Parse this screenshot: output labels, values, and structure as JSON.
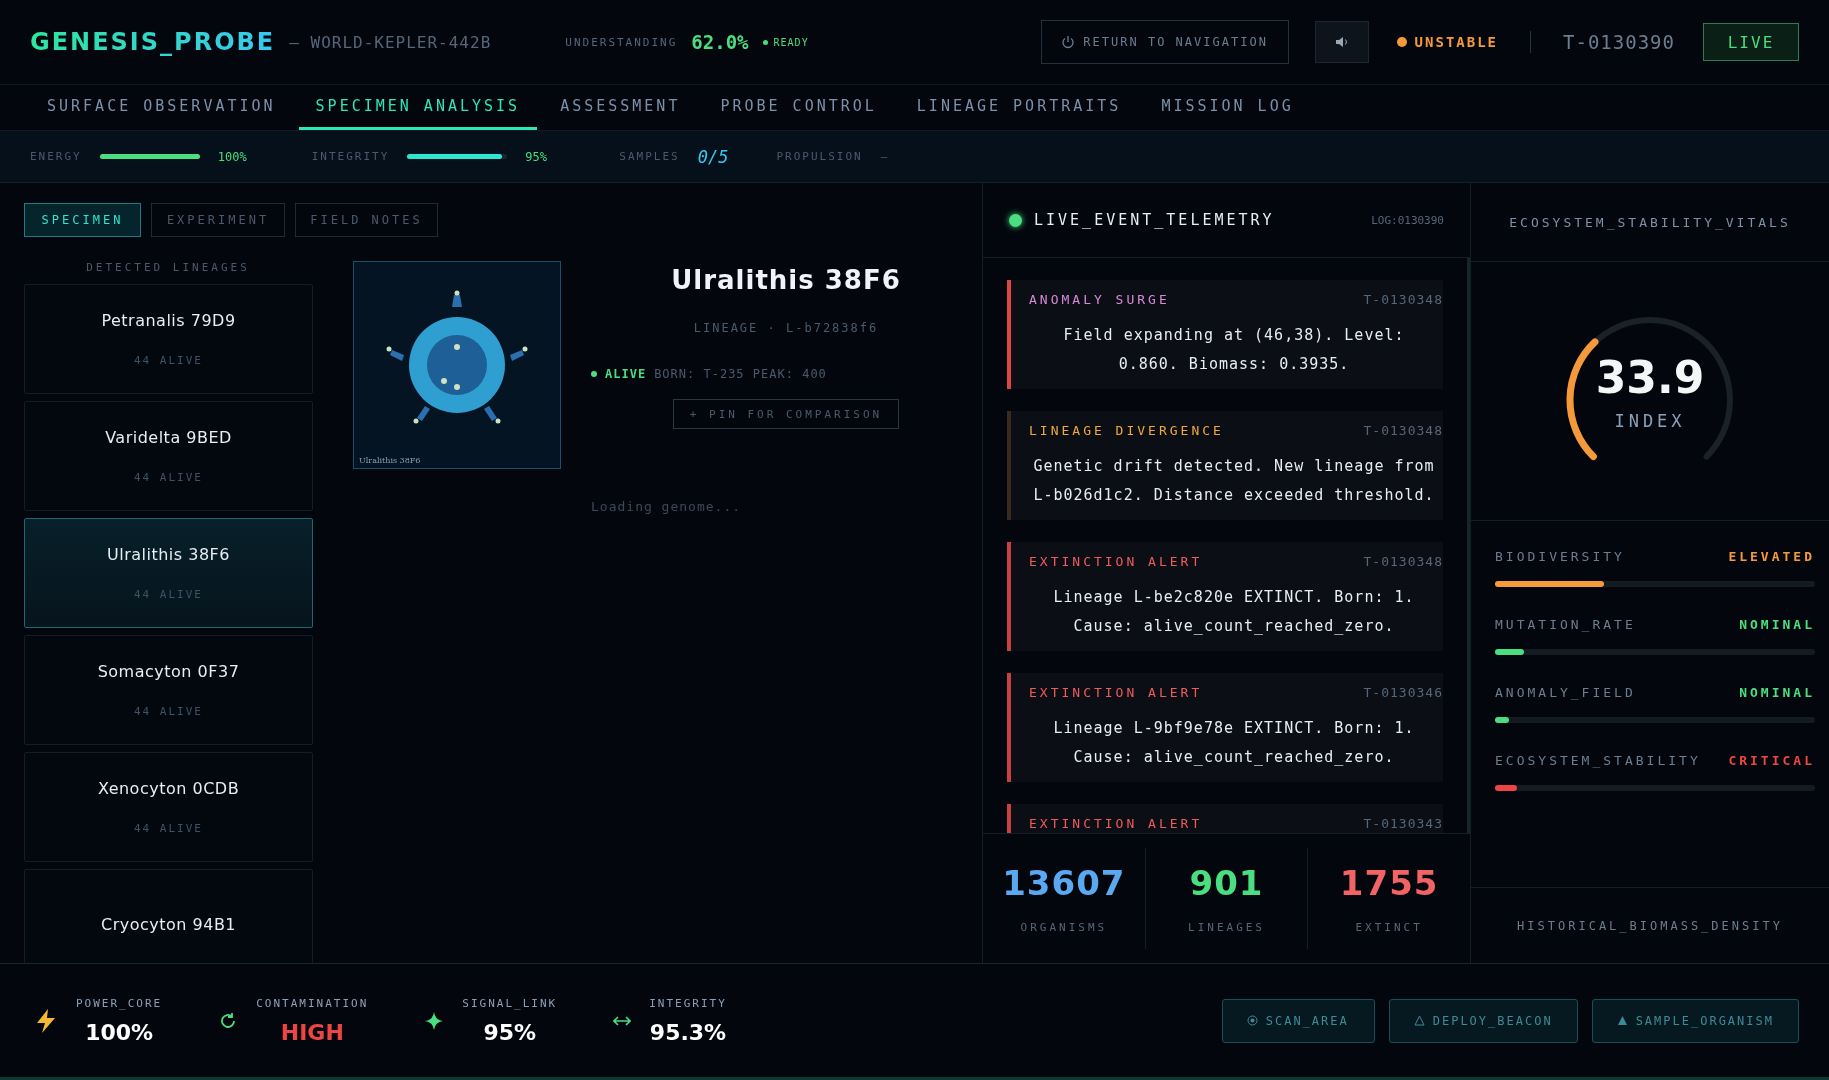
{
  "header": {
    "title": "GENESIS_PROBE",
    "world": "— WORLD-KEPLER-442B",
    "understanding_label": "UNDERSTANDING",
    "understanding_value": "62.0%",
    "ready": "READY",
    "return_button": "RETURN TO NAVIGATION",
    "stability": "UNSTABLE",
    "tick": "T-0130390",
    "live_button": "LIVE"
  },
  "tabs": [
    {
      "label": "SURFACE OBSERVATION",
      "selected": false
    },
    {
      "label": "SPECIMEN ANALYSIS",
      "selected": true
    },
    {
      "label": "ASSESSMENT",
      "selected": false
    },
    {
      "label": "PROBE CONTROL",
      "selected": false
    },
    {
      "label": "LINEAGE PORTRAITS",
      "selected": false
    },
    {
      "label": "MISSION LOG",
      "selected": false
    }
  ],
  "status_bar": {
    "energy": {
      "label": "ENERGY",
      "level": 1.0,
      "reading": "100%"
    },
    "integrity": {
      "label": "INTEGRITY",
      "level": 0.95,
      "reading": "95%"
    },
    "samples_label": "SAMPLES",
    "samples_value": "0/5",
    "propulsion_label": "PROPULSION",
    "propulsion_value": "—"
  },
  "subtabs": [
    {
      "label": "SPECIMEN",
      "selected": true
    },
    {
      "label": "EXPERIMENT",
      "selected": false
    },
    {
      "label": "FIELD NOTES",
      "selected": false
    }
  ],
  "lineages": {
    "heading": "DETECTED LINEAGES",
    "items": [
      {
        "name": "Petranalis 79D9",
        "alive": "44 ALIVE",
        "selected": false
      },
      {
        "name": "Varidelta 9BED",
        "alive": "44 ALIVE",
        "selected": false
      },
      {
        "name": "Ulralithis 38F6",
        "alive": "44 ALIVE",
        "selected": true
      },
      {
        "name": "Somacyton 0F37",
        "alive": "44 ALIVE",
        "selected": false
      },
      {
        "name": "Xenocyton 0CDB",
        "alive": "44 ALIVE",
        "selected": false
      },
      {
        "name": "Cryocyton 94B1",
        "selected": false
      }
    ]
  },
  "specimen": {
    "image_caption": "Ulralithis 38F6",
    "name": "Ulralithis 38F6",
    "lineage": "LINEAGE · L-b72838f6",
    "status": "ALIVE",
    "born": "BORN: T-235 PEAK: 400",
    "pin_button": "+ PIN FOR COMPARISON",
    "loading": "Loading genome..."
  },
  "telemetry": {
    "title": "LIVE_EVENT_TELEMETRY",
    "log": "LOG:0130390",
    "events": [
      {
        "kind": "anomaly",
        "title": "ANOMALY SURGE",
        "time": "T-0130348",
        "text": "Field expanding at (46,38). Level: 0.860. Biomass: 0.3935."
      },
      {
        "kind": "divergence",
        "title": "LINEAGE DIVERGENCE",
        "time": "T-0130348",
        "text": "Genetic drift detected. New lineage from L-b026d1c2. Distance exceeded threshold."
      },
      {
        "kind": "extinction",
        "title": "EXTINCTION ALERT",
        "time": "T-0130348",
        "text": "Lineage L-be2c820e EXTINCT. Born: 1. Cause: alive_count_reached_zero."
      },
      {
        "kind": "extinction",
        "title": "EXTINCTION ALERT",
        "time": "T-0130346",
        "text": "Lineage L-9bf9e78e EXTINCT. Born: 1. Cause: alive_count_reached_zero."
      },
      {
        "kind": "extinction",
        "title": "EXTINCTION ALERT",
        "time": "T-0130343"
      }
    ],
    "stats": [
      {
        "kind": "organisms",
        "value": "13607",
        "label": "ORGANISMS"
      },
      {
        "kind": "lineages",
        "value": "901",
        "label": "LINEAGES"
      },
      {
        "kind": "extinct",
        "value": "1755",
        "label": "EXTINCT"
      }
    ]
  },
  "vitals": {
    "title": "ECOSYSTEM_STABILITY_VITALS",
    "gauge": {
      "value": "33.9",
      "label": "INDEX"
    },
    "metrics": [
      {
        "name": "BIODIVERSITY",
        "status": "ELEVATED",
        "kind": "warn",
        "level": 0.34
      },
      {
        "name": "MUTATION_RATE",
        "status": "NOMINAL",
        "kind": "ok",
        "level": 0.09
      },
      {
        "name": "ANOMALY_FIELD",
        "status": "NOMINAL",
        "kind": "ok",
        "level": 0.045
      },
      {
        "name": "ECOSYSTEM_STABILITY",
        "status": "CRITICAL",
        "kind": "critical",
        "level": 0.07
      }
    ],
    "history_title": "HISTORICAL_BIOMASS_DENSITY"
  },
  "footer": {
    "readouts": [
      {
        "kind": "power",
        "label": "POWER_CORE",
        "value": "100%"
      },
      {
        "kind": "contamination",
        "label": "CONTAMINATION",
        "value": "HIGH"
      },
      {
        "kind": "signal",
        "label": "SIGNAL_LINK",
        "value": "95%"
      },
      {
        "kind": "integrity",
        "label": "INTEGRITY",
        "value": "95.3%"
      }
    ],
    "actions": [
      {
        "kind": "scan",
        "label": "SCAN_AREA"
      },
      {
        "kind": "beacon",
        "label": "DEPLOY_BEACON"
      },
      {
        "kind": "sample",
        "label": "SAMPLE_ORGANISM"
      }
    ]
  }
}
